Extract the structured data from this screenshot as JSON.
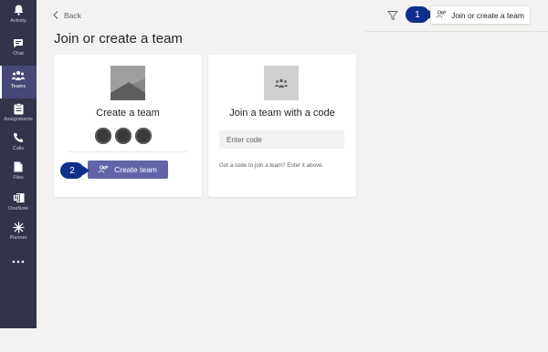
{
  "rail": {
    "items": [
      {
        "label": "Activity",
        "icon": "bell-icon"
      },
      {
        "label": "Chat",
        "icon": "chat-icon"
      },
      {
        "label": "Teams",
        "icon": "teams-icon"
      },
      {
        "label": "Assignments",
        "icon": "assignments-icon"
      },
      {
        "label": "Calls",
        "icon": "phone-icon"
      },
      {
        "label": "Files",
        "icon": "files-icon"
      },
      {
        "label": "OneNote",
        "icon": "onenote-icon"
      },
      {
        "label": "Planner",
        "icon": "planner-icon"
      },
      {
        "label": "",
        "icon": "more-icon"
      }
    ],
    "active": "Teams"
  },
  "topbar": {
    "back_label": "Back",
    "join_create_label": "Join or create a team"
  },
  "callouts": {
    "one": "1",
    "two": "2"
  },
  "page": {
    "title": "Join or create a team"
  },
  "create_card": {
    "title": "Create a team",
    "button_label": "Create team"
  },
  "join_card": {
    "title": "Join a team with a code",
    "input_value": "",
    "input_placeholder": "Enter code",
    "hint": "Got a code to join a team? Enter it above."
  },
  "colors": {
    "rail_bg": "#33344a",
    "rail_active": "#464775",
    "brand": "#6264a7",
    "callout": "#0f2f8a",
    "page_bg": "#f3f2f1"
  }
}
